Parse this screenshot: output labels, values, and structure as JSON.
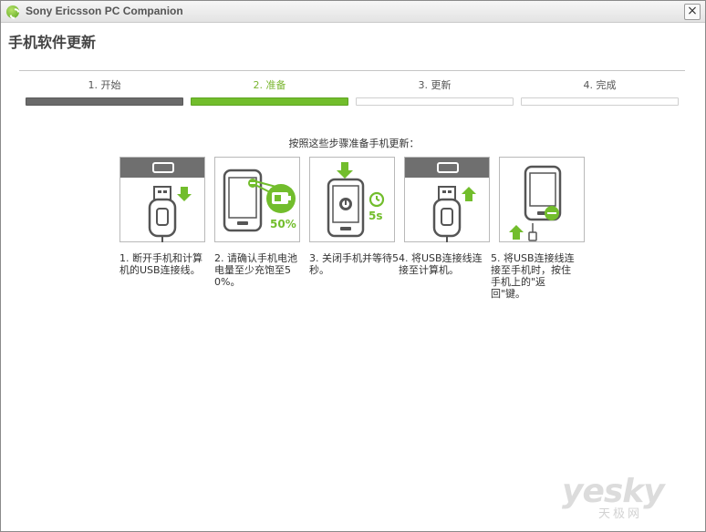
{
  "window": {
    "title": "Sony Ericsson PC Companion",
    "close_label": "×"
  },
  "page": {
    "title": "手机软件更新"
  },
  "steps": [
    {
      "label": "1. 开始",
      "state": "done"
    },
    {
      "label": "2. 准备",
      "state": "active"
    },
    {
      "label": "3. 更新",
      "state": "pending"
    },
    {
      "label": "4. 完成",
      "state": "pending"
    }
  ],
  "instruction": "按照这些步骤准备手机更新：",
  "cards": [
    {
      "text": "1. 断开手机和计算机的USB连接线。",
      "icon": "usb-unplug-icon"
    },
    {
      "text": "2. 请确认手机电池电量至少充饱至50%。",
      "icon": "battery-50-icon",
      "badge": "50%"
    },
    {
      "text": "3. 关闭手机并等待5秒。",
      "icon": "power-off-icon",
      "badge": "5s"
    },
    {
      "text": "4. 将USB连接线连接至计算机。",
      "icon": "usb-plug-icon"
    },
    {
      "text": "5. 将USB连接线连接至手机时，按住手机上的\"返回\"键。",
      "icon": "phone-connect-icon"
    }
  ],
  "watermark": {
    "text": "yesky",
    "sub": "天极网"
  },
  "colors": {
    "accent": "#72bd2c",
    "done_bar": "#6a6a6a",
    "card_cap": "#6f6f6f"
  }
}
